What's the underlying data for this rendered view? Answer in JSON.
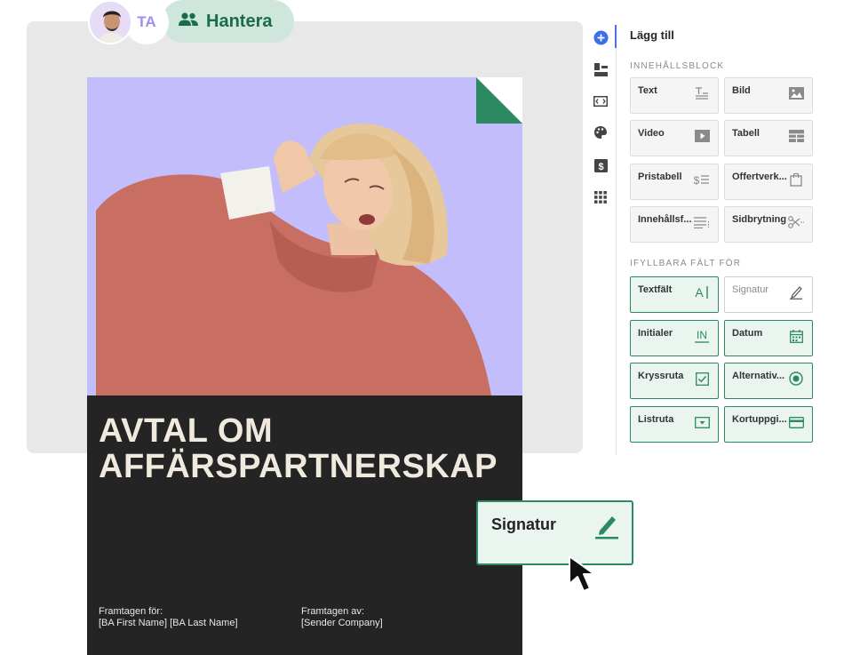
{
  "collaborators": {
    "initials": "TA",
    "manage_label": "Hantera"
  },
  "document": {
    "title_line1": "AVTAL OM",
    "title_line2": "AFFÄRSPARTNERSKAP",
    "prepared_for_label": "Framtagen för:",
    "prepared_for_value": "[BA First Name] [BA Last Name]",
    "prepared_by_label": "Framtagen av:",
    "prepared_by_value": "[Sender Company]"
  },
  "drag_chip": {
    "label": "Signatur",
    "icon": "pen-icon"
  },
  "sidebar": {
    "rail_icons": [
      "add-icon",
      "blocks-icon",
      "embed-icon",
      "palette-icon",
      "pricing-icon",
      "apps-icon"
    ],
    "title": "Lägg till",
    "content_blocks_label": "INNEHÅLLSBLOCK",
    "content_blocks": [
      {
        "label": "Text",
        "icon": "text-icon"
      },
      {
        "label": "Bild",
        "icon": "image-icon"
      },
      {
        "label": "Video",
        "icon": "video-icon"
      },
      {
        "label": "Tabell",
        "icon": "table-icon"
      },
      {
        "label": "Pristabell",
        "icon": "price-table-icon"
      },
      {
        "label": "Offertverk...",
        "icon": "bag-icon"
      },
      {
        "label": "Innehållsf...",
        "icon": "content-list-icon"
      },
      {
        "label": "Sidbrytning",
        "icon": "scissors-icon"
      }
    ],
    "fillable_label": "IFYLLBARA FÄLT FÖR",
    "fillable_fields": [
      {
        "label": "Textfält",
        "icon": "text-field-icon"
      },
      {
        "label": "Signatur",
        "icon": "signature-icon"
      },
      {
        "label": "Initialer",
        "icon": "initials-icon"
      },
      {
        "label": "Datum",
        "icon": "calendar-icon"
      },
      {
        "label": "Kryssruta",
        "icon": "checkbox-icon"
      },
      {
        "label": "Alternativ...",
        "icon": "radio-icon"
      },
      {
        "label": "Listruta",
        "icon": "dropdown-icon"
      },
      {
        "label": "Kortuppgi...",
        "icon": "card-icon"
      }
    ]
  },
  "colors": {
    "accent_green": "#2c8a63",
    "rail_blue": "#4c6fe6",
    "photo_bg": "#c4bdfb",
    "doc_dark": "#242424"
  }
}
